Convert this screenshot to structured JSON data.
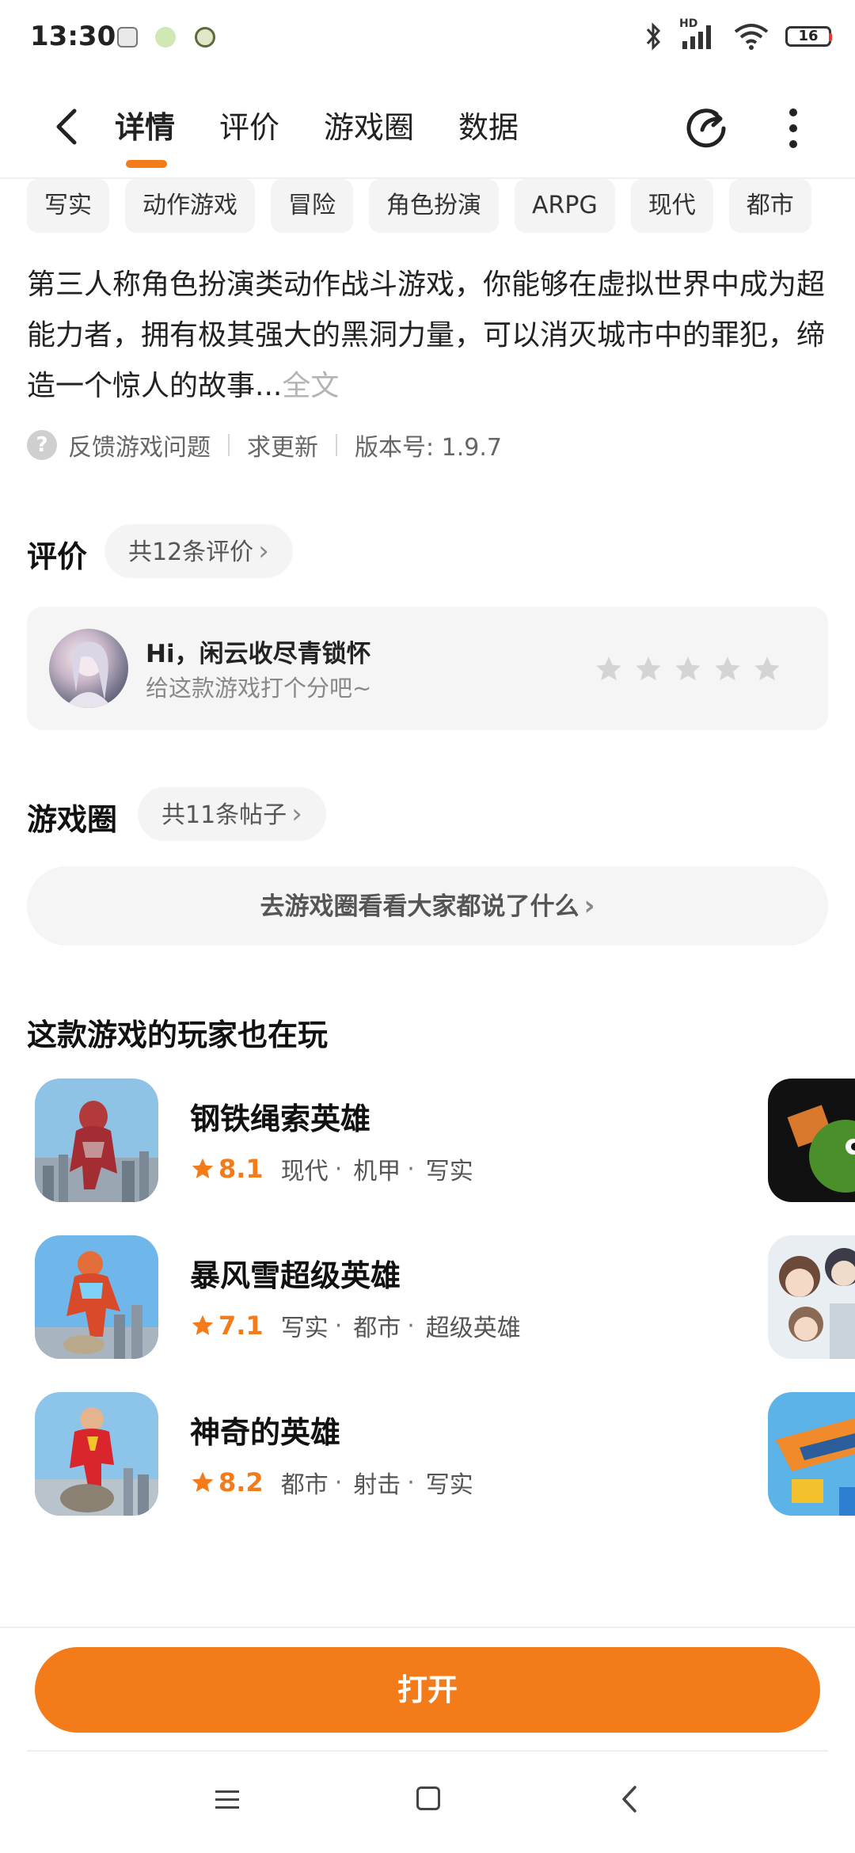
{
  "status_bar": {
    "time": "13:30",
    "network": "HD",
    "battery": "16"
  },
  "header": {
    "tabs": [
      {
        "label": "详情",
        "active": true
      },
      {
        "label": "评价",
        "active": false
      },
      {
        "label": "游戏圈",
        "active": false
      },
      {
        "label": "数据",
        "active": false
      }
    ]
  },
  "tags": [
    "写实",
    "动作游戏",
    "冒险",
    "角色扮演",
    "ARPG",
    "现代",
    "都市"
  ],
  "description": {
    "text": "第三人称角色扮演类动作战斗游戏，你能够在虚拟世界中成为超能力者，拥有极其强大的黑洞力量，可以消灭城市中的罪犯，缔造一个惊人的故事...",
    "more_label": "全文"
  },
  "meta": {
    "feedback_label": "反馈游戏问题",
    "update_label": "求更新",
    "version_label": "版本号: 1.9.7"
  },
  "reviews": {
    "title": "评价",
    "count_label": "共12条评价",
    "greeting": "Hi，闲云收尽青锁怀",
    "prompt": "给这款游戏打个分吧~",
    "rating": 0
  },
  "community": {
    "title": "游戏圈",
    "count_label": "共11条帖子",
    "cta_label": "去游戏圈看看大家都说了什么"
  },
  "recommendations": {
    "title": "这款游戏的玩家也在玩",
    "games": [
      {
        "name": "钢铁绳索英雄",
        "score": "8.1",
        "tags": [
          "现代",
          "机甲",
          "写实"
        ]
      },
      {
        "name": "暴风雪超级英雄",
        "score": "7.1",
        "tags": [
          "写实",
          "都市",
          "超级英雄"
        ]
      },
      {
        "name": "神奇的英雄",
        "score": "8.2",
        "tags": [
          "都市",
          "射击",
          "写实"
        ]
      }
    ]
  },
  "footer": {
    "open_label": "打开"
  },
  "colors": {
    "accent": "#f47b1a",
    "chip_bg": "#f4f4f4",
    "muted_text": "#888888"
  }
}
